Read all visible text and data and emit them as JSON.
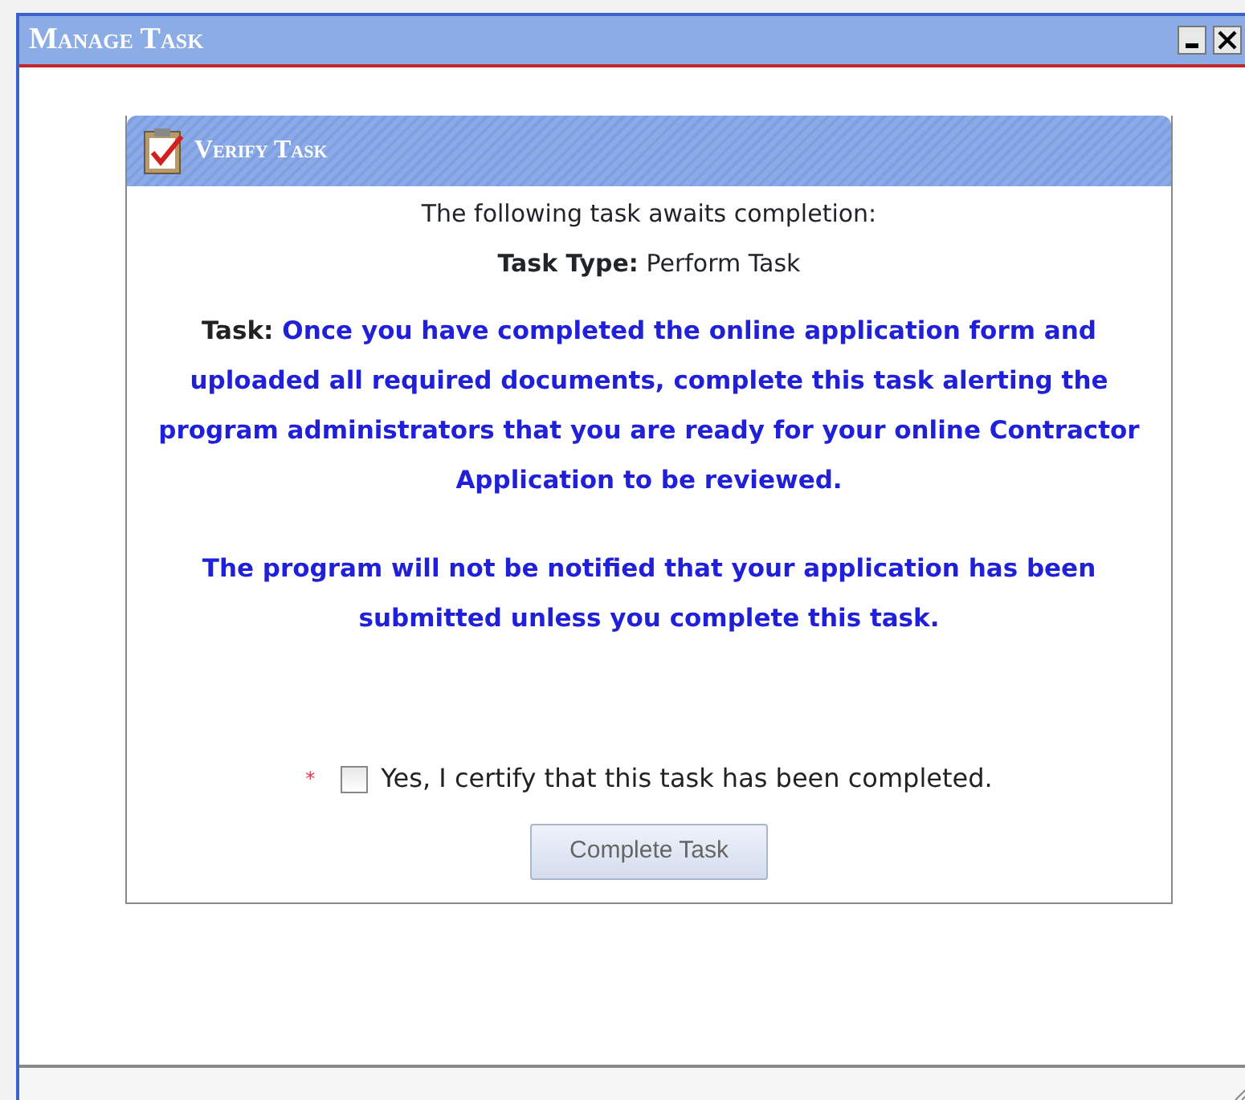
{
  "window": {
    "title": "Manage Task"
  },
  "panel": {
    "title": "Verify Task",
    "intro": "The following task awaits completion:",
    "task_type": "**Task Type:** Perform Task",
    "task": "**Task:** Once you have completed the online application form and uploaded all required documents, complete this task alerting the program administrators that you are ready for your online Contractor Application to be reviewed.",
    "notice": "The program will not be notified that your application has been submitted unless you complete this task.",
    "certify": {
      "required_mark": "*",
      "label": "Yes, I certify that this task has been completed.",
      "checked": false
    },
    "button": {
      "label": "Complete Task",
      "disabled": true
    }
  }
}
